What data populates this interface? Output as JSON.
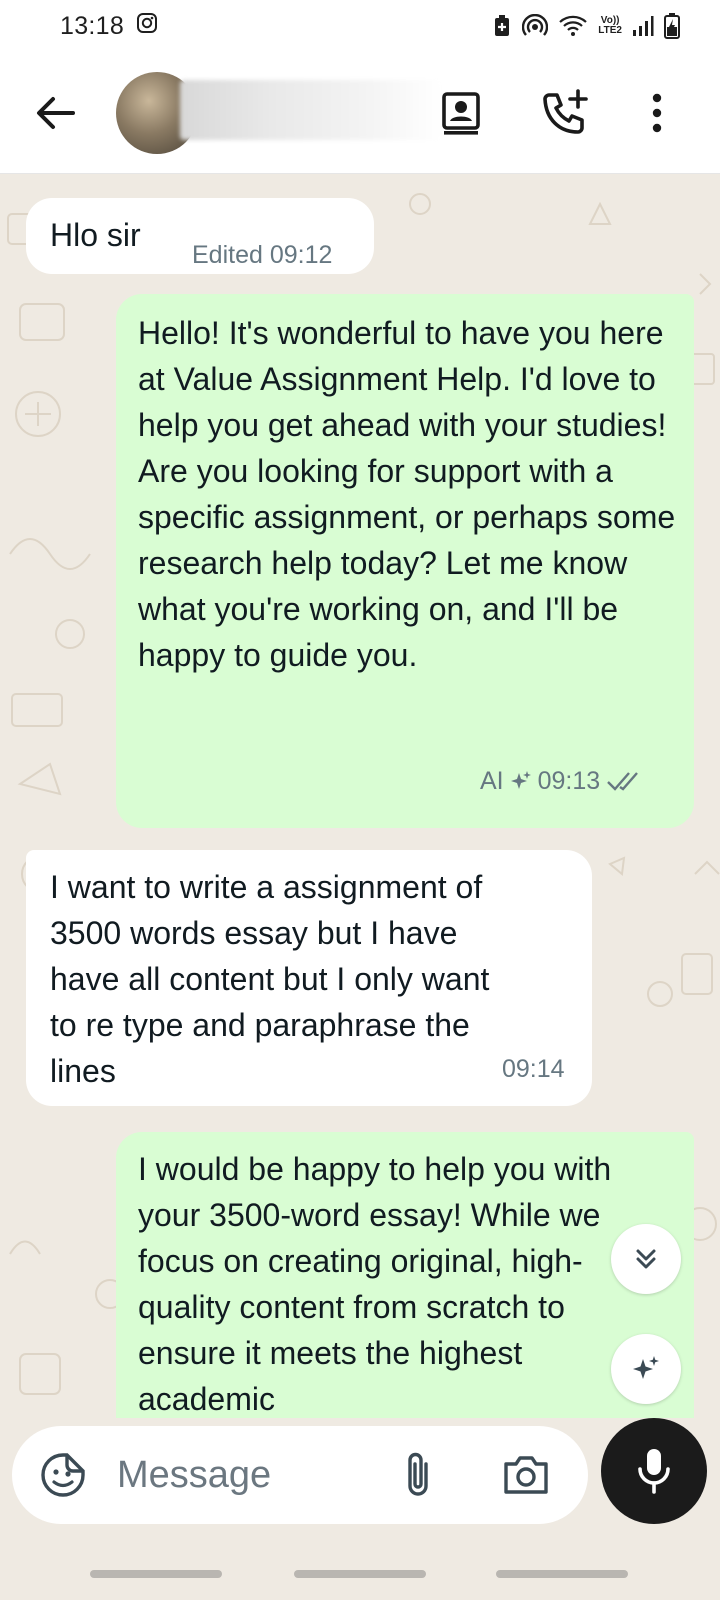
{
  "status_bar": {
    "time": "13:18",
    "volte_label": "Vo))",
    "lte_label": "LTE2",
    "icons": [
      "instagram-icon",
      "data-saver-icon",
      "hotspot-icon",
      "wifi-icon",
      "signal-icon",
      "battery-icon"
    ]
  },
  "header": {
    "back_icon": "arrow-left-icon",
    "actions": [
      "contact-card-icon",
      "add-call-icon",
      "more-vert-icon"
    ]
  },
  "messages": [
    {
      "direction": "incoming",
      "text": "Hlo sir",
      "meta": "Edited 09:12"
    },
    {
      "direction": "outgoing",
      "text": "Hello! It's wonderful to have you here at Value Assignment Help. I'd love to help you get ahead with your studies! Are you looking for support with a specific assignment, or perhaps some research help today? Let me know what you're working on, and I'll be happy to guide you.",
      "ai_label": "AI",
      "time": "09:13",
      "status": "read"
    },
    {
      "direction": "incoming",
      "text": "I want to write a assignment of 3500 words essay but I have have all content but I only want to re type and paraphrase the lines",
      "time": "09:14"
    },
    {
      "direction": "outgoing",
      "text": "I would be happy to help you with your 3500-word essay! While we focus on creating original, high-quality content from scratch to ensure it meets the highest academic"
    }
  ],
  "input": {
    "placeholder": "Message",
    "icons": [
      "sticker-icon",
      "attach-icon",
      "camera-icon",
      "mic-icon"
    ]
  },
  "floating": [
    "scroll-down-icon",
    "ai-sparkle-icon"
  ],
  "colors": {
    "chat_bg": "#efeae2",
    "incoming_bubble": "#ffffff",
    "outgoing_bubble": "#d9fdd3",
    "meta_text": "#667781",
    "mic_button": "#1b1b1b"
  }
}
